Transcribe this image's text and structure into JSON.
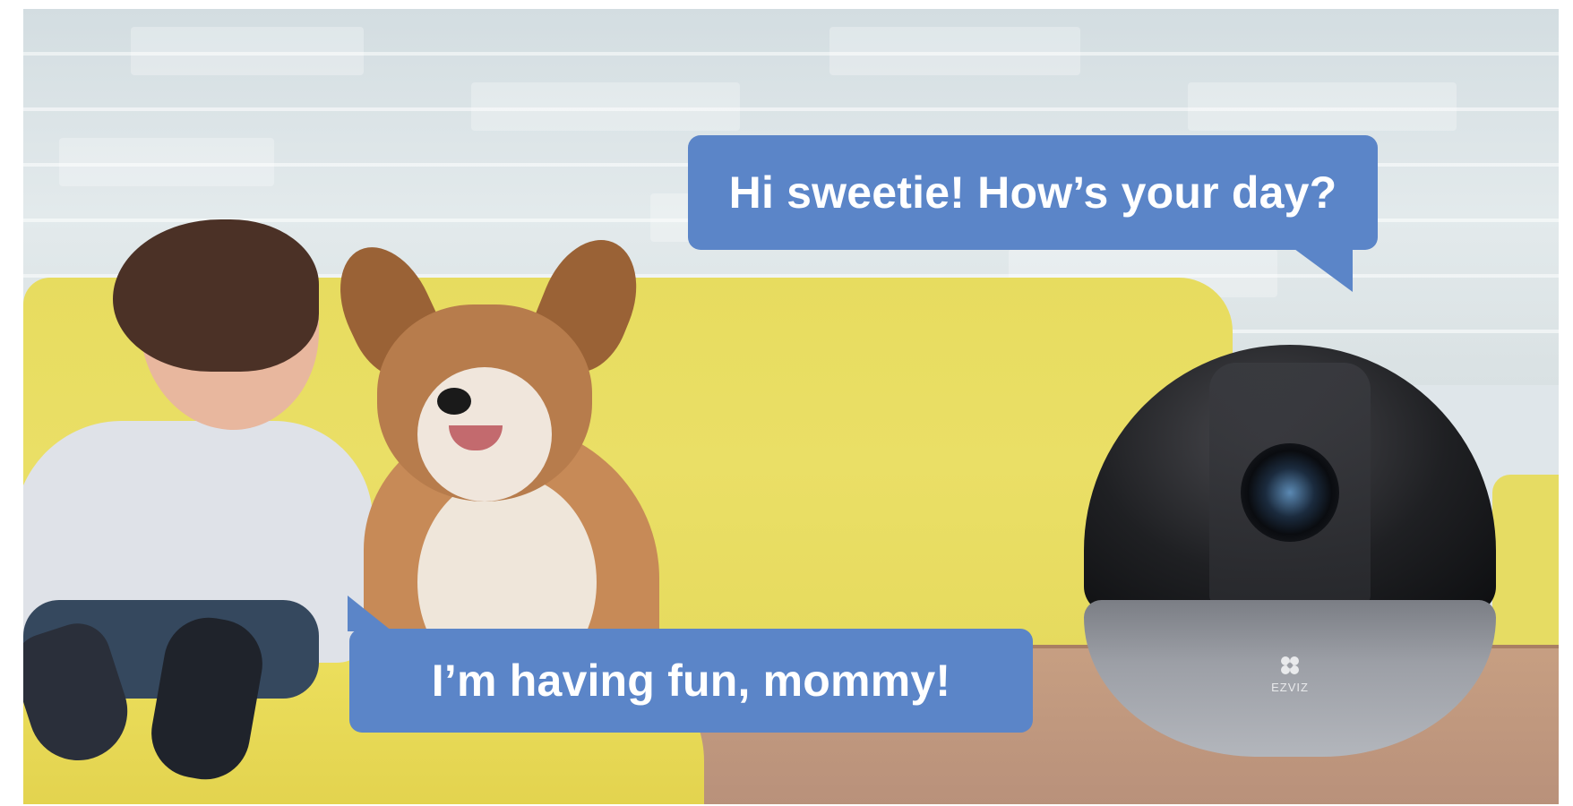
{
  "scene": {
    "description_free": true
  },
  "bubbles": {
    "camera_speech": "Hi sweetie! How’s your day?",
    "child_speech": "I’m having fun, mommy!",
    "bubble_color": "#5b85c8",
    "text_color": "#ffffff"
  },
  "camera": {
    "brand": "EZVIZ",
    "brand_icon": "fan-logo-icon"
  }
}
